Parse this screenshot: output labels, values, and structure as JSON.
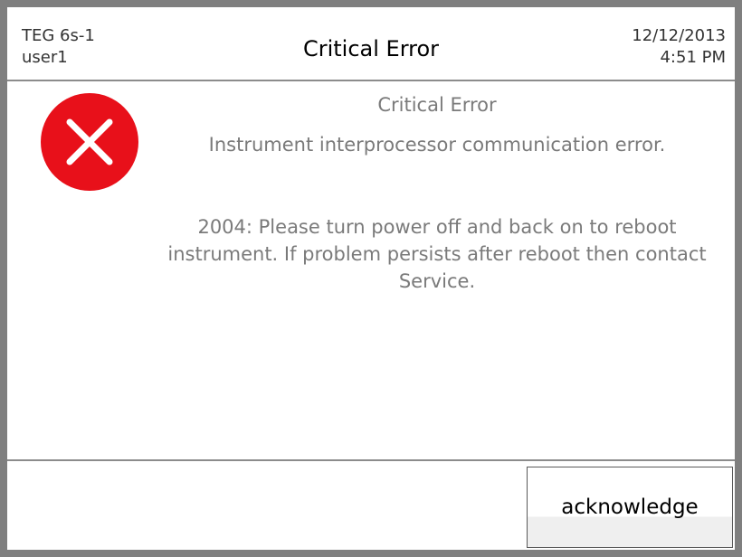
{
  "header": {
    "device": "TEG 6s-1",
    "user": "user1",
    "title": "Critical Error",
    "date": "12/12/2013",
    "time": "4:51 PM"
  },
  "message": {
    "title": "Critical Error",
    "line": "Instrument interprocessor communication error.",
    "body": "2004: Please turn power off and back on to reboot instrument. If problem persists after reboot then contact Service."
  },
  "icon": {
    "name": "error-x-icon",
    "color": "#e8101a"
  },
  "footer": {
    "acknowledge_label": "acknowledge"
  }
}
